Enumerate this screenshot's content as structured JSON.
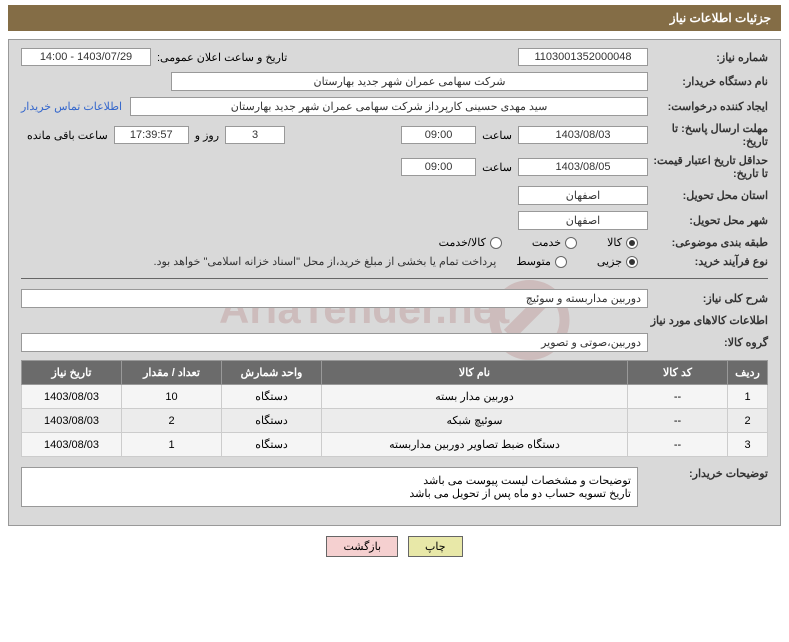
{
  "header": {
    "title": "جزئیات اطلاعات نیاز"
  },
  "rows": {
    "need_no_label": "شماره نیاز:",
    "need_no": "1103001352000048",
    "announce_label": "تاریخ و ساعت اعلان عمومی:",
    "announce_value": "1403/07/29 - 14:00",
    "buyer_label": "نام دستگاه خریدار:",
    "buyer_value": "شرکت سهامی عمران شهر جدید بهارستان",
    "requester_label": "ایجاد کننده درخواست:",
    "requester_value": "سید مهدی حسینی کارپرداز شرکت سهامی عمران شهر جدید بهارستان",
    "contact_link": "اطلاعات تماس خریدار",
    "deadline_label": "مهلت ارسال پاسخ: تا تاریخ:",
    "deadline_date": "1403/08/03",
    "time_label": "ساعت",
    "deadline_time": "09:00",
    "days_count": "3",
    "days_label": "روز و",
    "countdown_time": "17:39:57",
    "remaining_label": "ساعت باقی مانده",
    "validity_label": "حداقل تاریخ اعتبار قیمت: تا تاریخ:",
    "validity_date": "1403/08/05",
    "validity_time": "09:00",
    "province_label": "استان محل تحویل:",
    "province_value": "اصفهان",
    "city_label": "شهر محل تحویل:",
    "city_value": "اصفهان",
    "category_label": "طبقه بندی موضوعی:",
    "category_opts": {
      "goods": "کالا",
      "service": "خدمت",
      "both": "کالا/خدمت"
    },
    "process_label": "نوع فرآیند خرید:",
    "process_opts": {
      "partial": "جزیی",
      "medium": "متوسط"
    },
    "process_note": "پرداخت تمام یا بخشی از مبلغ خرید،از محل \"اسناد خزانه اسلامی\" خواهد بود.",
    "summary_label": "شرح کلی نیاز:",
    "summary_value": "دوربین مداربسته و سوئیچ",
    "goods_info_title": "اطلاعات کالاهای مورد نیاز",
    "goods_group_label": "گروه کالا:",
    "goods_group_value": "دوربین،صوتی و تصویر",
    "buyer_notes_label": "توضیحات خریدار:",
    "buyer_notes_line1": "توضیحات و مشخصات لیست پیوست می باشد",
    "buyer_notes_line2": "تاریخ تسویه حساب دو ماه پس از تحویل می باشد"
  },
  "table": {
    "headers": {
      "num": "ردیف",
      "code": "کد کالا",
      "name": "نام کالا",
      "unit": "واحد شمارش",
      "qty": "تعداد / مقدار",
      "date": "تاریخ نیاز"
    },
    "rows": [
      {
        "num": "1",
        "code": "--",
        "name": "دوربین مدار بسته",
        "unit": "دستگاه",
        "qty": "10",
        "date": "1403/08/03"
      },
      {
        "num": "2",
        "code": "--",
        "name": "سوئیچ شبکه",
        "unit": "دستگاه",
        "qty": "2",
        "date": "1403/08/03"
      },
      {
        "num": "3",
        "code": "--",
        "name": "دستگاه ضبط تصاویر دوربین مداربسته",
        "unit": "دستگاه",
        "qty": "1",
        "date": "1403/08/03"
      }
    ]
  },
  "buttons": {
    "print": "چاپ",
    "back": "بازگشت"
  }
}
